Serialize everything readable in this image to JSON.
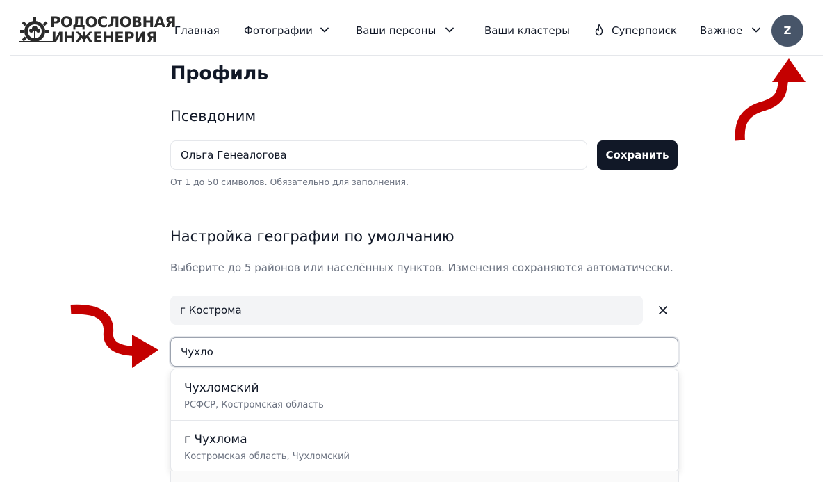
{
  "header": {
    "logo": {
      "line1": "РОДОСЛОВНАЯ",
      "line2": "ИНЖЕНЕРИЯ"
    },
    "nav": {
      "home": "Главная",
      "photos": "Фотографии",
      "persons": "Ваши персоны",
      "clusters": "Ваши кластеры",
      "supersearch": "Суперпоиск",
      "important": "Важное"
    },
    "avatar_letter": "Z"
  },
  "profile": {
    "title": "Профиль",
    "nickname_heading": "Псевдоним",
    "nickname_value": "Ольга Генеалогова",
    "save_label": "Сохранить",
    "nickname_hint": "От 1 до 50 символов. Обязательно для заполнения."
  },
  "geo": {
    "heading": "Настройка географии по умолчанию",
    "hint": "Выберите до 5 районов или населённых пунктов. Изменения сохраняются автоматически.",
    "selected": [
      {
        "label": "г Кострома"
      }
    ],
    "search_value": "Чухло",
    "suggestions": [
      {
        "title": "Чухломский",
        "subtitle": "РСФСР, Костромская область"
      },
      {
        "title": "г Чухлома",
        "subtitle": "Костромская область, Чухломский"
      }
    ]
  },
  "colors": {
    "primary_button": "#111827",
    "avatar": "#475569",
    "annotation_arrow": "#c40000",
    "muted_text": "#6b7280"
  },
  "icons": [
    "gear-tree-logo-icon",
    "chevron-down-icon",
    "fire-icon",
    "close-icon",
    "annotation-arrow-icon"
  ]
}
